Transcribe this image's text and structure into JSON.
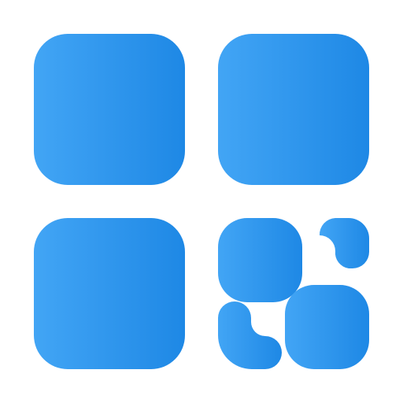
{
  "icon": {
    "name": "apps-grid-icon",
    "colors": {
      "gradient_start": "#42A5F5",
      "gradient_end": "#1E88E5",
      "background": "#FFFFFF"
    },
    "tiles": [
      {
        "name": "tile-top-left"
      },
      {
        "name": "tile-top-right"
      },
      {
        "name": "tile-bottom-left"
      },
      {
        "name": "mini-tile-top-left"
      },
      {
        "name": "mini-tile-top-right-corner"
      },
      {
        "name": "mini-tile-bottom-right"
      },
      {
        "name": "mini-tile-bottom-left-corner"
      }
    ]
  }
}
